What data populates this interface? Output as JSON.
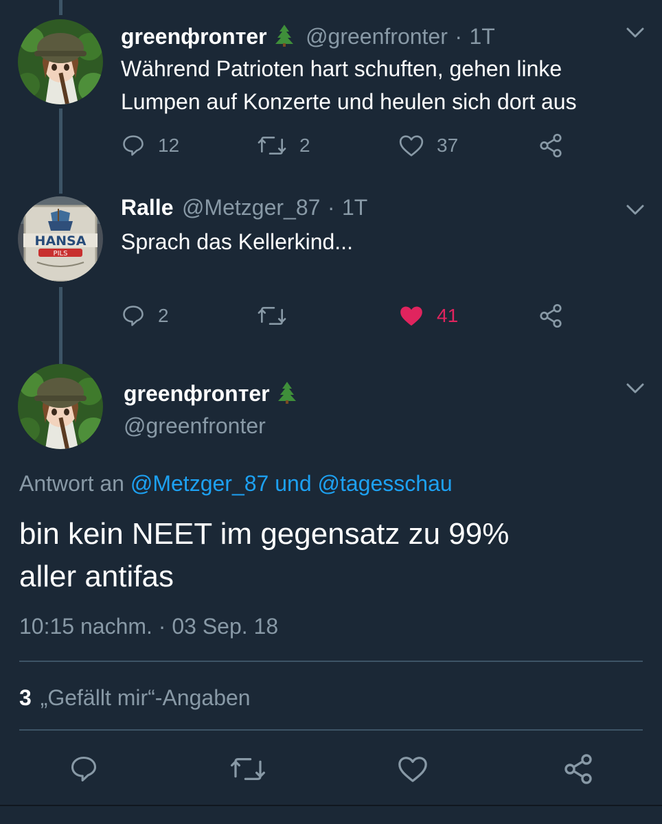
{
  "tweets": [
    {
      "name": "greenфronтer",
      "handle": "@greenfronter",
      "sep": "·",
      "time": "1T",
      "text_line1": "Während Patrioten hart schuften, gehen linke",
      "text_line2": "Lumpen auf Konzerte und heulen sich dort aus",
      "replies": "12",
      "retweets": "2",
      "likes": "37"
    },
    {
      "name": "Ralle",
      "handle": "@Metzger_87",
      "sep": "·",
      "time": "1T",
      "text_line1": "Sprach das Kellerkind...",
      "replies": "2",
      "retweets": "",
      "likes": "41"
    }
  ],
  "avatar2": {
    "brand": "HANSA",
    "sub": "PILS"
  },
  "main": {
    "name": "greenфronтer",
    "handle": "@greenfronter",
    "reply_prefix": "Antwort an",
    "reply_user1": "@Metzger_87",
    "reply_and": "und",
    "reply_user2": "@tagesschau",
    "text_line1": "bin kein NEET im gegensatz zu 99%",
    "text_line2": "aller antifas",
    "timestamp": "10:15 nachm. · 03 Sep. 18",
    "likes_count": "3",
    "likes_label": "„Gefällt mir“-Angaben"
  },
  "colors": {
    "background": "#1b2836",
    "secondary_text": "#8899a6",
    "link": "#1da1f2",
    "like_active": "#e0245e",
    "divider": "#3d5466"
  }
}
